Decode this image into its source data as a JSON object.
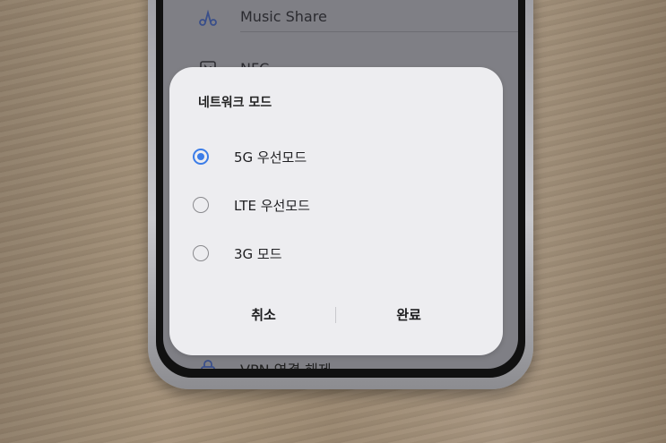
{
  "settings_list": {
    "music_share": {
      "label": "Music Share",
      "icon": "music-share-icon"
    },
    "nfc": {
      "label": "NFC",
      "icon": "nfc-icon"
    },
    "vpn": {
      "label": "VPN 연결 해제",
      "icon": "lock-icon"
    }
  },
  "dialog": {
    "title": "네트워크 모드",
    "options": [
      {
        "label": "5G 우선모드",
        "selected": true
      },
      {
        "label": "LTE 우선모드",
        "selected": false
      },
      {
        "label": "3G 모드",
        "selected": false
      }
    ],
    "cancel_label": "취소",
    "ok_label": "완료"
  },
  "colors": {
    "accent": "#3c7de8",
    "dialog_bg": "#ededf0"
  }
}
